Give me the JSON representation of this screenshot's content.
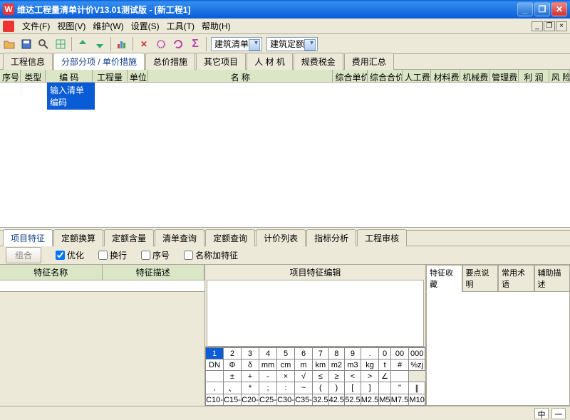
{
  "titlebar": {
    "title": "维达工程量清单计价V13.01测试版 - [新工程1]"
  },
  "menu": {
    "items": [
      "文件(F)",
      "视图(V)",
      "维护(W)",
      "设置(S)",
      "工具(T)",
      "帮助(H)"
    ]
  },
  "combos": {
    "a": "建筑清单",
    "b": "建筑定额"
  },
  "tabs": {
    "items": [
      "工程信息",
      "分部分项 / 单价措施",
      "总价措施",
      "其它项目",
      "人 材 机",
      "规费税金",
      "费用汇总"
    ],
    "active": 1
  },
  "grid_headers": [
    "序号",
    "类型",
    "编   码",
    "工程量",
    "单位",
    "名    称",
    "综合单价",
    "综合合价",
    "人工费",
    "材料费",
    "机械费",
    "管理费",
    "利  润",
    "风 险"
  ],
  "grid_col_widths": [
    30,
    36,
    68,
    50,
    30,
    268,
    50,
    50,
    42,
    42,
    42,
    42,
    44,
    30
  ],
  "input_placeholder": "输入清单编码",
  "tabs2": {
    "items": [
      "项目特征",
      "定额换算",
      "定额含量",
      "清单查询",
      "定额查询",
      "计价列表",
      "指标分析",
      "工程审核"
    ],
    "active": 0
  },
  "subbar": {
    "btn": "组合",
    "opt1": "优化",
    "opt2": "换行",
    "opt3": "序号",
    "opt4": "名称加特征"
  },
  "left": {
    "h1": "特征名称",
    "h2": "特征描述"
  },
  "mid": {
    "title": "项目特征编辑"
  },
  "right": {
    "tabs": [
      "特征收藏",
      "要点说明",
      "常用术语",
      "辅助描述"
    ],
    "active": 0
  },
  "kb": {
    "r1": [
      "1",
      "2",
      "3",
      "4",
      "5",
      "6",
      "7",
      "8",
      "9",
      ".",
      "0",
      "00",
      "000"
    ],
    "r2": [
      "DN",
      "Φ",
      "δ",
      "mm",
      "cm",
      "m",
      "km",
      "m2",
      "m3",
      "kg",
      "t",
      "#",
      "%zj"
    ],
    "r3": [
      "",
      "±",
      "+",
      "-",
      "×",
      "√",
      "≤",
      "≥",
      "<",
      ">",
      "∠",
      ""
    ],
    "r4": [
      ",",
      "、",
      "*",
      ";",
      ":",
      "~",
      "(",
      ")",
      "[",
      "]",
      "",
      "\"",
      "∥"
    ],
    "r5": [
      "C10-",
      "C15-",
      "C20-",
      "C25-",
      "C30-",
      "C35-",
      "32.5",
      "42.5",
      "52.5",
      "M2.5",
      "M5",
      "M7.5",
      "M10"
    ]
  },
  "status": {
    "a": "中",
    "b": "一"
  }
}
